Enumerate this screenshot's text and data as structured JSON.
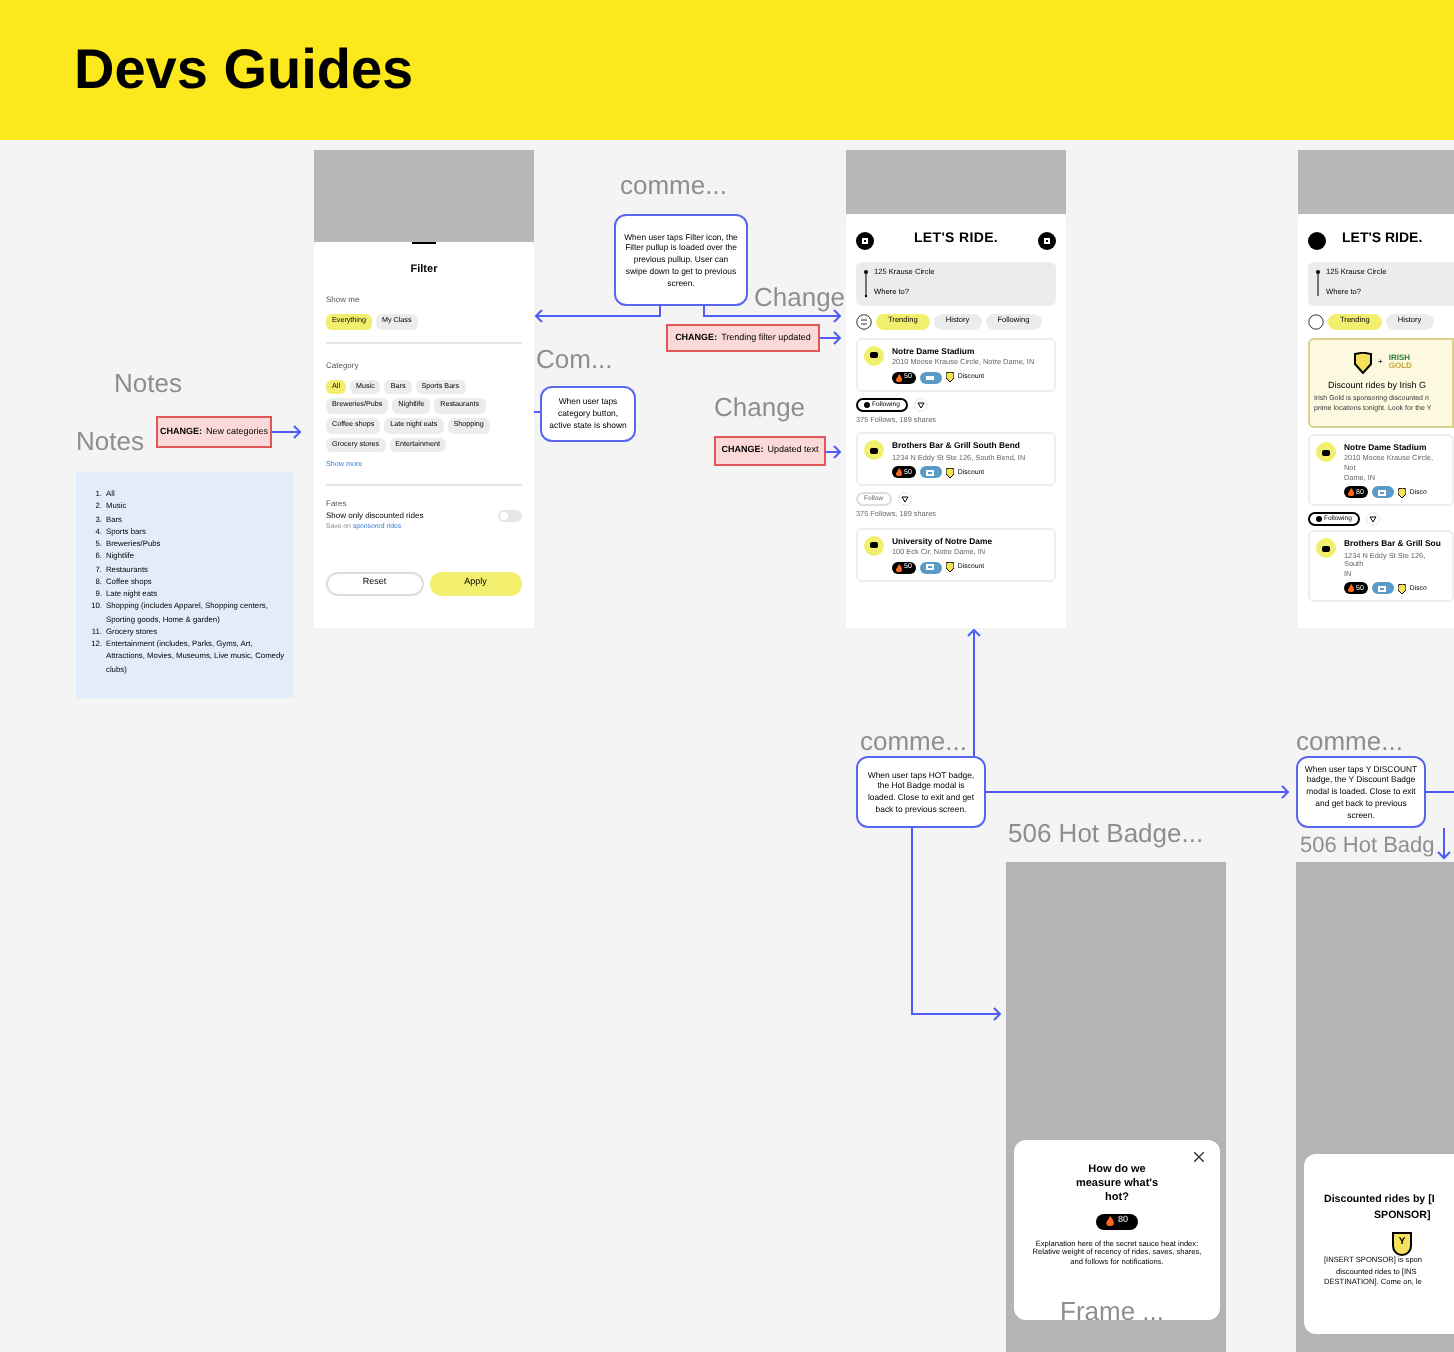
{
  "header": {
    "title": "Devs Guides"
  },
  "notes": {
    "labels": [
      "Notes",
      "Notes"
    ],
    "list": [
      {
        "number": "1.",
        "text": "All"
      },
      {
        "number": "2.",
        "text": "Music"
      },
      {
        "number": "3.",
        "text": "Bars"
      },
      {
        "number": "4.",
        "text": "Sports bars"
      },
      {
        "number": "5.",
        "text": "Breweries/Pubs"
      },
      {
        "number": "6.",
        "text": "Nightlife"
      },
      {
        "number": "7.",
        "text": "Restaurants"
      },
      {
        "number": "8.",
        "text": "Coffee shops"
      },
      {
        "number": "9.",
        "text": "Late night eats"
      },
      {
        "number": "10.",
        "text": "Shopping (includes Apparel, Shopping centers, Sporting goods, Home & garden)"
      },
      {
        "number": "11.",
        "text": "Grocery stores"
      },
      {
        "number": "12.",
        "text": "Entertainment (includes, Parks, Gyms, Art, Attractions, Movies, Museums, Live music, Comedy clubs)"
      }
    ]
  },
  "change_notes": [
    {
      "tag": "CHANGE:",
      "text": "New categories"
    },
    {
      "heading": "Change",
      "tag": "CHANGE:",
      "text": "Trending filter updated"
    },
    {
      "heading": "Change",
      "tag": "CHANGE:",
      "text": "Updated text"
    }
  ],
  "comments": [
    {
      "title": "comme...",
      "text": "When user taps Filter icon, the Filter pullup is loaded over the previous pullup. User can swipe down to get to previous screen."
    },
    {
      "title": "Com...",
      "text": "When user taps category button, active state is shown"
    },
    {
      "title": "comme...",
      "text": "When user taps HOT badge, the Hot Badge modal is loaded. Close to exit and get back to previous screen."
    },
    {
      "title": "comme...",
      "text": "When user taps Y DISCOUNT badge, the Y Discount Badge modal is loaded. Close to exit and get back to previous screen."
    }
  ],
  "filter_screen": {
    "title": "Filter",
    "show_me": {
      "label": "Show me",
      "options": [
        {
          "label": "Everything",
          "selected": true
        },
        {
          "label": "My Class",
          "selected": false
        }
      ]
    },
    "category": {
      "label": "Category",
      "options": [
        {
          "label": "All",
          "selected": true
        },
        {
          "label": "Music",
          "selected": false
        },
        {
          "label": "Bars",
          "selected": false
        },
        {
          "label": "Sports Bars",
          "selected": false
        },
        {
          "label": "Breweries/Pubs",
          "selected": false
        },
        {
          "label": "Nightlife",
          "selected": false
        },
        {
          "label": "Restaurants",
          "selected": false
        },
        {
          "label": "Coffee shops",
          "selected": false
        },
        {
          "label": "Late night eats",
          "selected": false
        },
        {
          "label": "Shopping",
          "selected": false
        },
        {
          "label": "Grocery stores",
          "selected": false
        },
        {
          "label": "Entertainment",
          "selected": false
        }
      ],
      "show_more": "Show more"
    },
    "fares": {
      "label": "Fares",
      "toggle_label": "Show only discounted rides",
      "on": false,
      "hint": "Save on",
      "hint_link": "sponsored rides"
    },
    "buttons": [
      {
        "label": "Reset",
        "kind": "secondary"
      },
      {
        "label": "Apply",
        "kind": "primary"
      }
    ]
  },
  "ride_screen": {
    "title": "LET'S RIDE.",
    "from": "125 Krause Circle",
    "to": "Where to?",
    "tabs": [
      {
        "label": "Trending",
        "selected": true
      },
      {
        "label": "History",
        "selected": false
      },
      {
        "label": "Following",
        "selected": false
      }
    ],
    "places": [
      {
        "name": "Notre Dame Stadium",
        "address": "2010 Moose Krause Circle, Notre Dame, IN",
        "hot": "50",
        "discount": "Discount",
        "follow": {
          "label": "Following",
          "following": true
        },
        "stats": "375 Follows, 189 shares"
      },
      {
        "name": "Brothers Bar & Grill South Bend",
        "address": "1234 N Eddy St Ste 126, South Bend, IN",
        "hot": "50",
        "discount": "Discount",
        "follow": {
          "label": "Follow",
          "following": false
        },
        "stats": "375 Follows, 189 shares"
      },
      {
        "name": "University of Notre Dame",
        "address": "100 Eck Cir, Notre Dame, IN",
        "hot": "50",
        "discount": "Discount"
      }
    ]
  },
  "sponsored_screen": {
    "title": "LET'S RIDE.",
    "from": "125 Krause Circle",
    "to": "Where to?",
    "tabs": [
      {
        "label": "Trending",
        "selected": true
      },
      {
        "label": "History",
        "selected": false
      }
    ],
    "sponsor": {
      "plus": "+",
      "logo": "IRISH",
      "logo_sub": "GOLD",
      "title": "Discount rides by Irish G",
      "body": [
        "Irish Gold is sponsoring discounted ri",
        "prime locations tonight. Look for the Y"
      ]
    },
    "places": [
      {
        "name": "Notre Dame Stadium",
        "address": "2010 Moose Krause Circle, Not",
        "address2": "Dame, IN",
        "hot": "80",
        "discount": "Disco",
        "follow": {
          "label": "Following",
          "following": true
        }
      },
      {
        "name": "Brothers Bar & Grill Sou",
        "address": "1234 N Eddy St Ste 126, South",
        "address2": "IN",
        "hot": "50",
        "discount": "Disco"
      }
    ]
  },
  "hot_badge_frame": {
    "title": "506 Hot Badge...",
    "overlay_label": "Frame ...",
    "modal": {
      "title": "How do we measure what's hot?",
      "badge": "80",
      "body": "Explanation here of the secret sauce heat index: Relative weight of recency of rides, saves, shares, and follows for notifications."
    }
  },
  "discount_frame": {
    "title": "506 Hot Badg",
    "modal": {
      "title_lines": [
        "Discounted rides by [I",
        "SPONSOR]"
      ],
      "badge": "Y",
      "body_lines": [
        "[INSERT SPONSOR] is spon",
        "discounted rides to [INS",
        "DESTINATION]. Come on, le"
      ]
    }
  }
}
